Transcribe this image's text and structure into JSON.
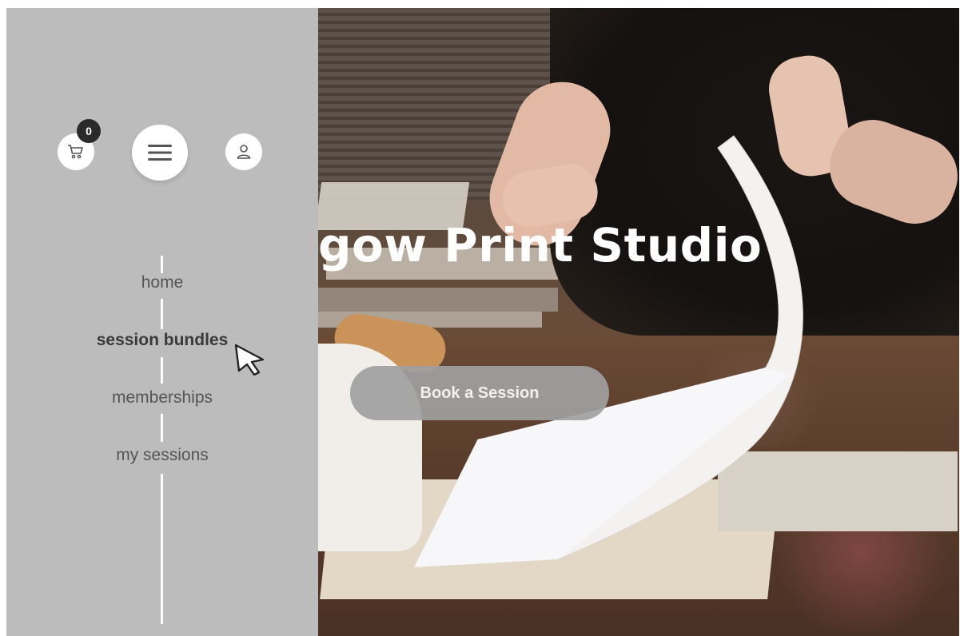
{
  "hero": {
    "headline": "gow Print Studio",
    "cta_label": "Book a Session"
  },
  "header_icons": {
    "cart_count": "0",
    "cart_icon": "cart-icon",
    "menu_icon": "hamburger-menu-icon",
    "user_icon": "user-icon"
  },
  "nav": {
    "items": [
      {
        "label": "home",
        "active": false
      },
      {
        "label": "session bundles",
        "active": true
      },
      {
        "label": "memberships",
        "active": false
      },
      {
        "label": "my sessions",
        "active": false
      }
    ]
  },
  "colors": {
    "sidebar_bg": "#bcbcbc",
    "cta_bg": "#a0a0a0",
    "badge_bg": "#2a2a2a",
    "nav_text": "#555555",
    "nav_active_text": "#3a3a3a"
  }
}
